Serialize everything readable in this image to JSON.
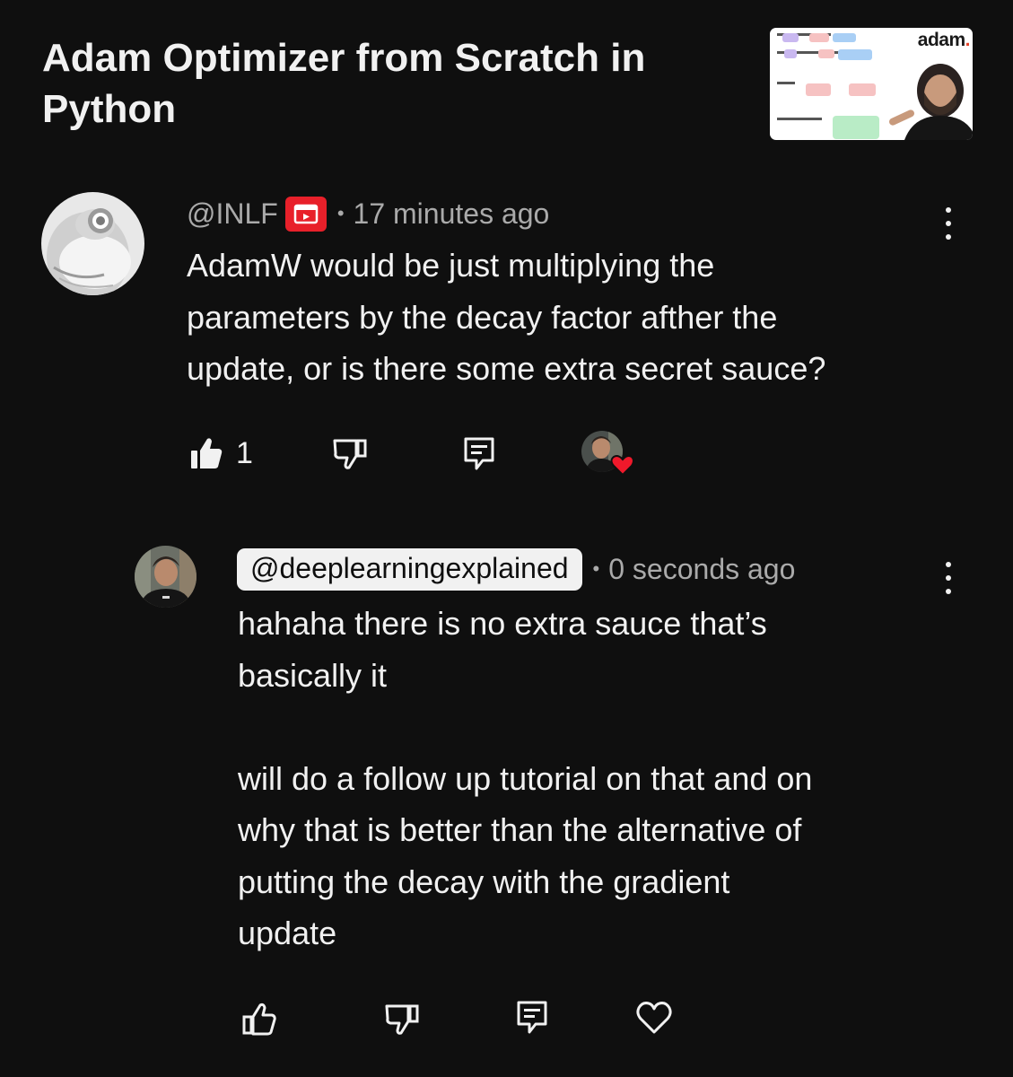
{
  "video": {
    "title_line1": "Adam Optimizer from Scratch in",
    "title_line2": "Python",
    "thumbnail": {
      "brand": "adam",
      "brand_dot": "."
    }
  },
  "comment": {
    "handle": "@INLF",
    "badge_icon": "youtube-member-badge-icon",
    "separator": "•",
    "time": "17 minutes ago",
    "text_lines": [
      "AdamW would be just multiplying the",
      "parameters by the decay factor afther the",
      "update, or is there some extra secret sauce?"
    ],
    "like_count": "1",
    "hearted_by_creator": true
  },
  "reply": {
    "handle": "@deeplearningexplained",
    "separator": "•",
    "time": "0 seconds ago",
    "paragraph1_lines": [
      "hahaha there is no extra sauce that’s",
      "basically it"
    ],
    "paragraph2_lines": [
      "will do a follow up tutorial on that and on",
      "why that is better than the alternative of",
      "putting the decay with the gradient",
      "update"
    ]
  },
  "colors": {
    "background": "#0f0f0f",
    "text_primary": "#f1f1f1",
    "text_secondary": "#aaaaaa",
    "badge_red": "#e8202a",
    "heart_red": "#f0192b"
  }
}
